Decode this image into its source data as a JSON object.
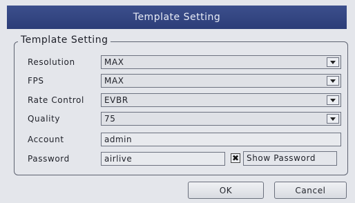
{
  "window": {
    "title": "Template Setting"
  },
  "group": {
    "legend": "Template Setting"
  },
  "fields": {
    "resolution": {
      "label": "Resolution",
      "value": "MAX"
    },
    "fps": {
      "label": "FPS",
      "value": "MAX"
    },
    "rate_control": {
      "label": "Rate Control",
      "value": "EVBR"
    },
    "quality": {
      "label": "Quality",
      "value": "75"
    },
    "account": {
      "label": "Account",
      "value": "admin"
    },
    "password": {
      "label": "Password",
      "value": "airlive"
    }
  },
  "show_password": {
    "label": "Show Password",
    "checked": true,
    "mark": "✖"
  },
  "buttons": {
    "ok": "OK",
    "cancel": "Cancel"
  },
  "icons": {
    "dropdown": "chevron-down-icon",
    "checkbox": "check-icon"
  },
  "colors": {
    "titlebar": "#2f4180",
    "background": "#e4e6eb"
  }
}
